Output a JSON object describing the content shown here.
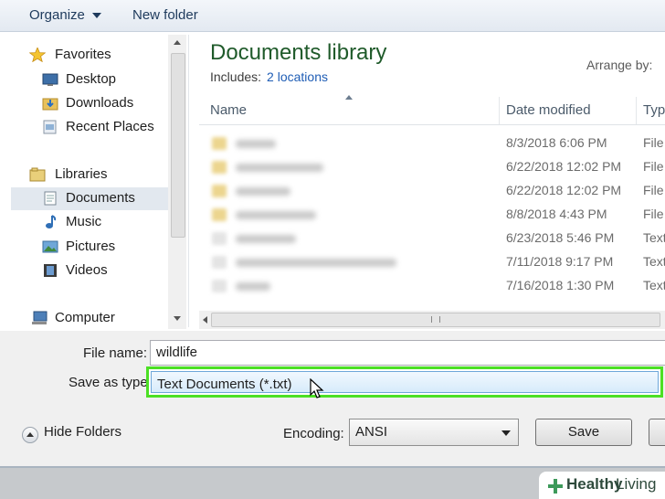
{
  "toolbar": {
    "organize": "Organize",
    "new_folder": "New folder"
  },
  "nav": {
    "favorites": "Favorites",
    "desktop": "Desktop",
    "downloads": "Downloads",
    "recent": "Recent Places",
    "libraries": "Libraries",
    "documents": "Documents",
    "music": "Music",
    "pictures": "Pictures",
    "videos": "Videos",
    "computer": "Computer"
  },
  "library": {
    "title": "Documents library",
    "includes_label": "Includes:",
    "locations_link": "2 locations",
    "arrange_label": "Arrange by:"
  },
  "columns": {
    "name": "Name",
    "date": "Date modified",
    "type": "Typ"
  },
  "rows": [
    {
      "date": "8/3/2018 6:06 PM",
      "type": "File"
    },
    {
      "date": "6/22/2018 12:02 PM",
      "type": "File"
    },
    {
      "date": "6/22/2018 12:02 PM",
      "type": "File"
    },
    {
      "date": "8/8/2018 4:43 PM",
      "type": "File"
    },
    {
      "date": "6/23/2018 5:46 PM",
      "type": "Text"
    },
    {
      "date": "7/11/2018 9:17 PM",
      "type": "Text"
    },
    {
      "date": "7/16/2018 1:30 PM",
      "type": "Text"
    }
  ],
  "form": {
    "file_name_label": "File name:",
    "file_name_value": "wildlife",
    "save_type_label": "Save as type:",
    "save_type_value": "Text Documents (*.txt)",
    "hide_folders": "Hide Folders",
    "encoding_label": "Encoding:",
    "encoding_value": "ANSI",
    "save": "Save"
  },
  "colors": {
    "highlight": "#4ce024",
    "library_title": "#1f5a2a",
    "link": "#1f5db5"
  },
  "watermark": {
    "part1": "Healthy",
    "part2": "Living"
  }
}
